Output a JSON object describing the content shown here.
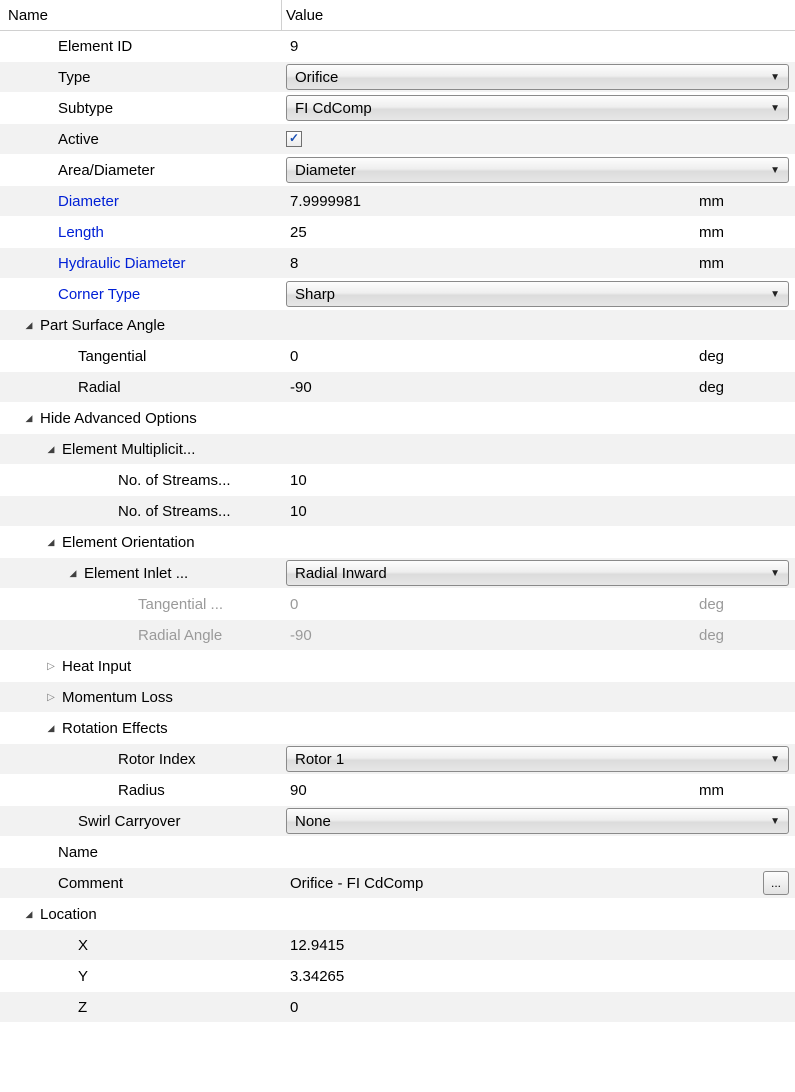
{
  "header": {
    "name": "Name",
    "value": "Value"
  },
  "rows": {
    "element_id": {
      "label": "Element ID",
      "value": "9"
    },
    "type": {
      "label": "Type",
      "value": "Orifice"
    },
    "subtype": {
      "label": "Subtype",
      "value": "FI CdComp"
    },
    "active": {
      "label": "Active"
    },
    "area_diameter": {
      "label": "Area/Diameter",
      "value": "Diameter"
    },
    "diameter": {
      "label": "Diameter",
      "value": "7.9999981",
      "unit": "mm"
    },
    "length": {
      "label": "Length",
      "value": "25",
      "unit": "mm"
    },
    "hydraulic_diameter": {
      "label": "Hydraulic Diameter",
      "value": "8",
      "unit": "mm"
    },
    "corner_type": {
      "label": "Corner Type",
      "value": "Sharp"
    },
    "part_surface_angle": {
      "label": "Part Surface Angle"
    },
    "tangential": {
      "label": "Tangential",
      "value": "0",
      "unit": "deg"
    },
    "radial": {
      "label": "Radial",
      "value": "-90",
      "unit": "deg"
    },
    "hide_adv": {
      "label": "Hide Advanced Options"
    },
    "elem_mult": {
      "label": "Element Multiplicit..."
    },
    "num_streams_1": {
      "label": "No. of Streams...",
      "value": "10"
    },
    "num_streams_2": {
      "label": "No. of Streams...",
      "value": "10"
    },
    "elem_orient": {
      "label": "Element Orientation"
    },
    "elem_inlet": {
      "label": "Element Inlet ...",
      "value": "Radial Inward"
    },
    "tang_angle": {
      "label": "Tangential ...",
      "value": "0",
      "unit": "deg"
    },
    "radial_angle": {
      "label": "Radial Angle",
      "value": "-90",
      "unit": "deg"
    },
    "heat_input": {
      "label": "Heat Input"
    },
    "momentum_loss": {
      "label": "Momentum Loss"
    },
    "rotation_effects": {
      "label": "Rotation Effects"
    },
    "rotor_index": {
      "label": "Rotor Index",
      "value": "Rotor 1"
    },
    "radius": {
      "label": "Radius",
      "value": "90",
      "unit": "mm"
    },
    "swirl_carryover": {
      "label": "Swirl Carryover",
      "value": "None"
    },
    "name": {
      "label": "Name",
      "value": ""
    },
    "comment": {
      "label": "Comment",
      "value": "Orifice - FI CdComp"
    },
    "location": {
      "label": "Location"
    },
    "x": {
      "label": "X",
      "value": "12.9415"
    },
    "y": {
      "label": "Y",
      "value": "3.34265"
    },
    "z": {
      "label": "Z",
      "value": "0"
    }
  }
}
